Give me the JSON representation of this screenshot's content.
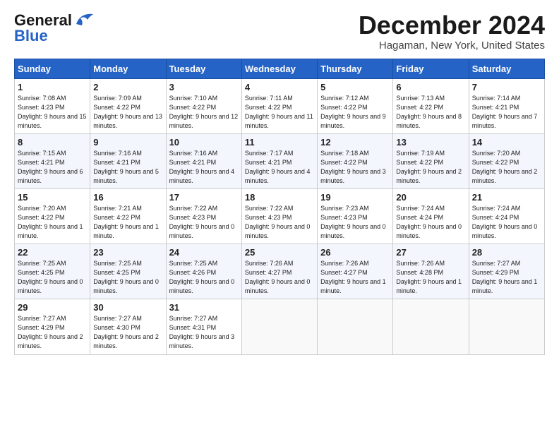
{
  "logo": {
    "general": "General",
    "blue": "Blue"
  },
  "title": "December 2024",
  "location": "Hagaman, New York, United States",
  "days_of_week": [
    "Sunday",
    "Monday",
    "Tuesday",
    "Wednesday",
    "Thursday",
    "Friday",
    "Saturday"
  ],
  "weeks": [
    [
      {
        "day": "1",
        "sunrise": "7:08 AM",
        "sunset": "4:23 PM",
        "daylight": "9 hours and 15 minutes."
      },
      {
        "day": "2",
        "sunrise": "7:09 AM",
        "sunset": "4:22 PM",
        "daylight": "9 hours and 13 minutes."
      },
      {
        "day": "3",
        "sunrise": "7:10 AM",
        "sunset": "4:22 PM",
        "daylight": "9 hours and 12 minutes."
      },
      {
        "day": "4",
        "sunrise": "7:11 AM",
        "sunset": "4:22 PM",
        "daylight": "9 hours and 11 minutes."
      },
      {
        "day": "5",
        "sunrise": "7:12 AM",
        "sunset": "4:22 PM",
        "daylight": "9 hours and 9 minutes."
      },
      {
        "day": "6",
        "sunrise": "7:13 AM",
        "sunset": "4:22 PM",
        "daylight": "9 hours and 8 minutes."
      },
      {
        "day": "7",
        "sunrise": "7:14 AM",
        "sunset": "4:21 PM",
        "daylight": "9 hours and 7 minutes."
      }
    ],
    [
      {
        "day": "8",
        "sunrise": "7:15 AM",
        "sunset": "4:21 PM",
        "daylight": "9 hours and 6 minutes."
      },
      {
        "day": "9",
        "sunrise": "7:16 AM",
        "sunset": "4:21 PM",
        "daylight": "9 hours and 5 minutes."
      },
      {
        "day": "10",
        "sunrise": "7:16 AM",
        "sunset": "4:21 PM",
        "daylight": "9 hours and 4 minutes."
      },
      {
        "day": "11",
        "sunrise": "7:17 AM",
        "sunset": "4:21 PM",
        "daylight": "9 hours and 4 minutes."
      },
      {
        "day": "12",
        "sunrise": "7:18 AM",
        "sunset": "4:22 PM",
        "daylight": "9 hours and 3 minutes."
      },
      {
        "day": "13",
        "sunrise": "7:19 AM",
        "sunset": "4:22 PM",
        "daylight": "9 hours and 2 minutes."
      },
      {
        "day": "14",
        "sunrise": "7:20 AM",
        "sunset": "4:22 PM",
        "daylight": "9 hours and 2 minutes."
      }
    ],
    [
      {
        "day": "15",
        "sunrise": "7:20 AM",
        "sunset": "4:22 PM",
        "daylight": "9 hours and 1 minute."
      },
      {
        "day": "16",
        "sunrise": "7:21 AM",
        "sunset": "4:22 PM",
        "daylight": "9 hours and 1 minute."
      },
      {
        "day": "17",
        "sunrise": "7:22 AM",
        "sunset": "4:23 PM",
        "daylight": "9 hours and 0 minutes."
      },
      {
        "day": "18",
        "sunrise": "7:22 AM",
        "sunset": "4:23 PM",
        "daylight": "9 hours and 0 minutes."
      },
      {
        "day": "19",
        "sunrise": "7:23 AM",
        "sunset": "4:23 PM",
        "daylight": "9 hours and 0 minutes."
      },
      {
        "day": "20",
        "sunrise": "7:24 AM",
        "sunset": "4:24 PM",
        "daylight": "9 hours and 0 minutes."
      },
      {
        "day": "21",
        "sunrise": "7:24 AM",
        "sunset": "4:24 PM",
        "daylight": "9 hours and 0 minutes."
      }
    ],
    [
      {
        "day": "22",
        "sunrise": "7:25 AM",
        "sunset": "4:25 PM",
        "daylight": "9 hours and 0 minutes."
      },
      {
        "day": "23",
        "sunrise": "7:25 AM",
        "sunset": "4:25 PM",
        "daylight": "9 hours and 0 minutes."
      },
      {
        "day": "24",
        "sunrise": "7:25 AM",
        "sunset": "4:26 PM",
        "daylight": "9 hours and 0 minutes."
      },
      {
        "day": "25",
        "sunrise": "7:26 AM",
        "sunset": "4:27 PM",
        "daylight": "9 hours and 0 minutes."
      },
      {
        "day": "26",
        "sunrise": "7:26 AM",
        "sunset": "4:27 PM",
        "daylight": "9 hours and 1 minute."
      },
      {
        "day": "27",
        "sunrise": "7:26 AM",
        "sunset": "4:28 PM",
        "daylight": "9 hours and 1 minute."
      },
      {
        "day": "28",
        "sunrise": "7:27 AM",
        "sunset": "4:29 PM",
        "daylight": "9 hours and 1 minute."
      }
    ],
    [
      {
        "day": "29",
        "sunrise": "7:27 AM",
        "sunset": "4:29 PM",
        "daylight": "9 hours and 2 minutes."
      },
      {
        "day": "30",
        "sunrise": "7:27 AM",
        "sunset": "4:30 PM",
        "daylight": "9 hours and 2 minutes."
      },
      {
        "day": "31",
        "sunrise": "7:27 AM",
        "sunset": "4:31 PM",
        "daylight": "9 hours and 3 minutes."
      },
      null,
      null,
      null,
      null
    ]
  ]
}
